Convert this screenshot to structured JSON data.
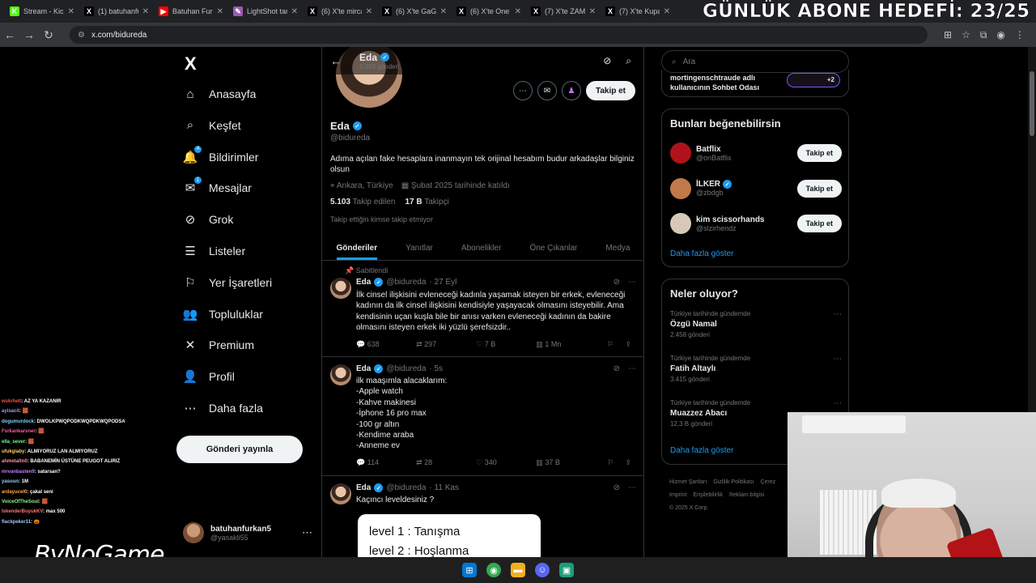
{
  "browser": {
    "tabs": [
      {
        "title": "Stream - Kick",
        "fav": "K",
        "color": "#53fc18"
      },
      {
        "title": "(1) batuhanfurkan",
        "fav": "X",
        "color": "#000000"
      },
      {
        "title": "Batuhan Furkan",
        "fav": "▶",
        "color": "#ff0000"
      },
      {
        "title": "LightShot tarayıcı",
        "fav": "✎",
        "color": "#9b59b6"
      },
      {
        "title": "(6) X'te mirca",
        "fav": "X",
        "color": "#000000"
      },
      {
        "title": "(6) X'te GaGa",
        "fav": "X",
        "color": "#000000"
      },
      {
        "title": "(6) X'te One",
        "fav": "X",
        "color": "#000000"
      },
      {
        "title": "(7) X'te ZAMA",
        "fav": "X",
        "color": "#000000"
      },
      {
        "title": "(7) X'te Kupa",
        "fav": "X",
        "color": "#000000"
      }
    ],
    "overlay_title": "GÜNLÜK ABONE HEDEFİ: 23/25",
    "url": "x.com/bidureda"
  },
  "sidebar": {
    "logo": "X",
    "items": [
      {
        "label": "Anasayfa",
        "icon": "home-icon",
        "glyph": "⌂"
      },
      {
        "label": "Keşfet",
        "icon": "search-icon",
        "glyph": "⌕"
      },
      {
        "label": "Bildirimler",
        "icon": "bell-icon",
        "glyph": "🔔",
        "badge": "4"
      },
      {
        "label": "Mesajlar",
        "icon": "mail-icon",
        "glyph": "✉",
        "badge": "1"
      },
      {
        "label": "Grok",
        "icon": "grok-icon",
        "glyph": "⊘"
      },
      {
        "label": "Listeler",
        "icon": "list-icon",
        "glyph": "☰"
      },
      {
        "label": "Yer İşaretleri",
        "icon": "bookmark-icon",
        "glyph": "⚐"
      },
      {
        "label": "Topluluklar",
        "icon": "people-icon",
        "glyph": "👥"
      },
      {
        "label": "Premium",
        "icon": "x-icon",
        "glyph": "✕"
      },
      {
        "label": "Profil",
        "icon": "person-icon",
        "glyph": "👤"
      },
      {
        "label": "Daha fazla",
        "icon": "more-circle-icon",
        "glyph": "⋯"
      }
    ],
    "post_button": "Gönderi yayınla",
    "user": {
      "name": "batuhanfurkan5",
      "handle": "@yasakli55"
    }
  },
  "profile": {
    "name": "Eda",
    "post_count": "8.358 gönderi",
    "handle": "@bidureda",
    "follow_label": "Takip et",
    "bio": "Adıma açılan fake hesaplara inanmayın tek orijinal hesabım budur arkadaşlar bilginiz olsun",
    "location": "Ankara, Türkiye",
    "joined": "Şubat 2025 tarihinde katıldı",
    "following_count": "5.103",
    "following_label": "Takip edilen",
    "followers_count": "17 B",
    "followers_label": "Takipçi",
    "note": "Takip ettiğin kimse takip etmiyor",
    "tabs": [
      "Gönderiler",
      "Yanıtlar",
      "Abonelikler",
      "Öne Çıkanlar",
      "Medya"
    ]
  },
  "tweets": [
    {
      "pinned": "Sabitlendi",
      "name": "Eda",
      "handle": "@bidureda",
      "time": "· 27 Eyl",
      "text": "İlk cinsel ilişkisini evleneceği kadınla yaşamak isteyen bir erkek, evleneceği kadının da ilk cinsel ilişkisini kendisiyle yaşayacak olmasını isteyebilir.  Ama kendisinin uçan kuşla bile bir anısı varken evleneceği kadının da bakire olmasını isteyen erkek iki yüzlü şerefsizdir..",
      "replies": "638",
      "reposts": "297",
      "likes": "7 B",
      "views": "1 Mn"
    },
    {
      "name": "Eda",
      "handle": "@bidureda",
      "time": "· 5s",
      "lines": [
        "ilk maaşımla alacaklarım:",
        "-Apple watch",
        "-Kahve makinesi",
        "-İphone 16 pro max",
        "-100 gr altın",
        "-Kendime araba",
        "-Anneme ev"
      ],
      "replies": "114",
      "reposts": "28",
      "likes": "340",
      "views": "37 B"
    },
    {
      "name": "Eda",
      "handle": "@bidureda",
      "time": "· 11 Kas",
      "text": "Kaçıncı leveldesiniz ?",
      "card_lines": [
        "level 1 : Tanışma",
        "level 2 : Hoşlanma"
      ]
    }
  ],
  "right": {
    "search_placeholder": "Ara",
    "space_text": "mortingenschtraude adlı kullanıcının Sohbet Odası",
    "space_count": "+2",
    "suggest_title": "Bunları beğenebilirsin",
    "suggest": [
      {
        "name": "Batflix",
        "handle": "@onBatflix",
        "verified": false,
        "color": "#b0121b"
      },
      {
        "name": "İLKER",
        "handle": "@zbdgb",
        "verified": true,
        "color": "#c07a4a"
      },
      {
        "name": "kim scissorhands",
        "handle": "@slzirhendz",
        "verified": false,
        "color": "#d8c8b8"
      }
    ],
    "follow_label": "Takip et",
    "show_more": "Daha fazla göster",
    "trends_title": "Neler oluyor?",
    "trends": [
      {
        "context": "Türkiye tarihinde gündemde",
        "topic": "Özgü Namal",
        "count": "2.458 gönderi"
      },
      {
        "context": "Türkiye tarihinde gündemde",
        "topic": "Fatih Altaylı",
        "count": "3.415 gönderi"
      },
      {
        "context": "Türkiye tarihinde gündemde",
        "topic": "Muazzez Abacı",
        "count": "12,3 B gönderi"
      }
    ],
    "footer": [
      "Hizmet Şartları",
      "Gizlilik Politikası",
      "Çerez",
      "Imprint",
      "Erişilebilirlik",
      "Reklam bilgisi",
      "© 2025 X Corp."
    ]
  },
  "chat": [
    {
      "user": "wskrhelt",
      "msg": ": AZ YA KAZANIR",
      "color": "#ff4d4d"
    },
    {
      "user": "ayisacit",
      "msg": ": 🧱",
      "color": "#9aa0ff"
    },
    {
      "user": "dogumurdock",
      "msg": ": DWOLKPWQPODKWQPDKWQPODSA",
      "color": "#7fd1ff"
    },
    {
      "user": "Furkankarsner",
      "msg": ": 🧱",
      "color": "#ff5aa0"
    },
    {
      "user": "ella_sever",
      "msg": ": 🧱",
      "color": "#6cff8f"
    },
    {
      "user": "ufukgiaby",
      "msg": ": ALMIYORUZ LAN ALMIYORUZ",
      "color": "#ffd166"
    },
    {
      "user": "ahmetaltn0",
      "msg": ": BABANEMİN ÜSTÜNE PEUGOT ALIRIZ",
      "color": "#ff8fab"
    },
    {
      "user": "mrvanbasten9",
      "msg": ": satarsan?",
      "color": "#c77dff"
    },
    {
      "user": "yasoun",
      "msg": ": 1M",
      "color": "#8fd3ff"
    },
    {
      "user": "ardayucel0",
      "msg": ": çakal seni",
      "color": "#ffa94d"
    },
    {
      "user": "VoiceOfTheSoul",
      "msg": ": 🧱",
      "color": "#90ee90"
    },
    {
      "user": "IskenderBuyukKV",
      "msg": ": max 500",
      "color": "#ff7676"
    },
    {
      "user": "flackpeker11",
      "msg": ": 🎃",
      "color": "#a0c4ff"
    }
  ],
  "streamer_tag": "ByNoGame"
}
